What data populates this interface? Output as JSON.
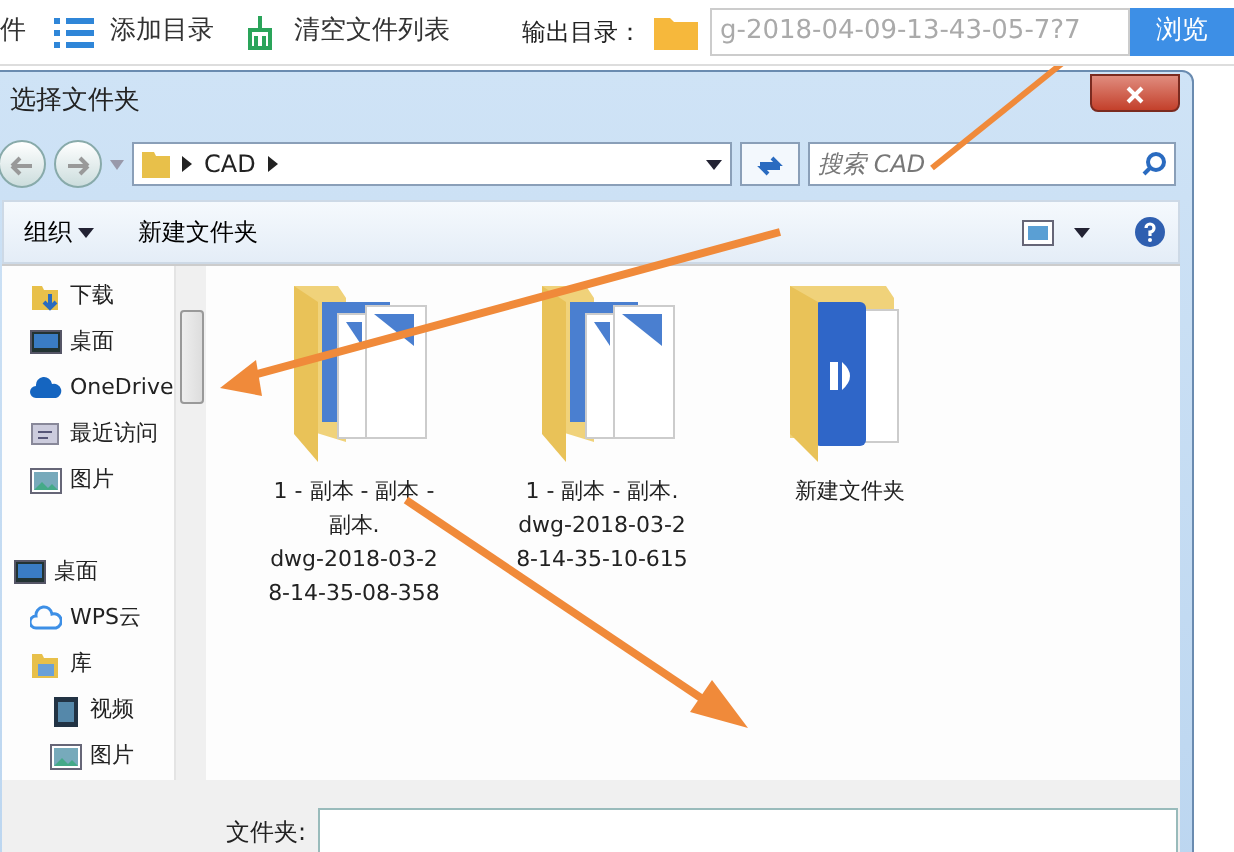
{
  "app_toolbar": {
    "items": [
      {
        "kind": "text",
        "label": "件"
      },
      {
        "kind": "list",
        "label": "添加目录"
      },
      {
        "kind": "broom",
        "label": "清空文件列表"
      }
    ],
    "output_label": "输出目录：",
    "output_path": "g-2018-04-09-13-43-05-7?7",
    "browse_button": "浏览"
  },
  "dialog": {
    "title": "选择文件夹",
    "address": {
      "crumbs": [
        "CAD"
      ]
    },
    "search": {
      "placeholder": "搜索 CAD"
    },
    "toolbar": {
      "organize": "组织",
      "new_folder": "新建文件夹"
    },
    "nav": [
      {
        "kind": "favorites",
        "children": [
          {
            "kind": "download",
            "label": "下载"
          },
          {
            "kind": "desktop",
            "label": "桌面"
          },
          {
            "kind": "cloud",
            "label": "OneDrive"
          },
          {
            "kind": "recent",
            "label": "最近访问"
          },
          {
            "kind": "picture",
            "label": "图片"
          }
        ]
      },
      {
        "kind": "desktop",
        "label": "桌面",
        "children": [
          {
            "kind": "cloud-outline",
            "label": "WPS云"
          },
          {
            "kind": "library",
            "label": "库",
            "children": [
              {
                "kind": "video",
                "label": "视频"
              },
              {
                "kind": "picture",
                "label": "图片"
              }
            ]
          }
        ]
      }
    ],
    "files": [
      {
        "kind": "cad-copies",
        "lines": [
          "1 - 副本 - 副本 -",
          "副本.",
          "dwg-2018-03-2",
          "8-14-35-08-358"
        ]
      },
      {
        "kind": "cad-copies",
        "lines": [
          "1 - 副本 - 副本.",
          "dwg-2018-03-2",
          "8-14-35-10-615"
        ]
      },
      {
        "kind": "cad-folder",
        "lines": [
          "新建文件夹"
        ]
      }
    ],
    "folder_label": "文件夹:"
  }
}
